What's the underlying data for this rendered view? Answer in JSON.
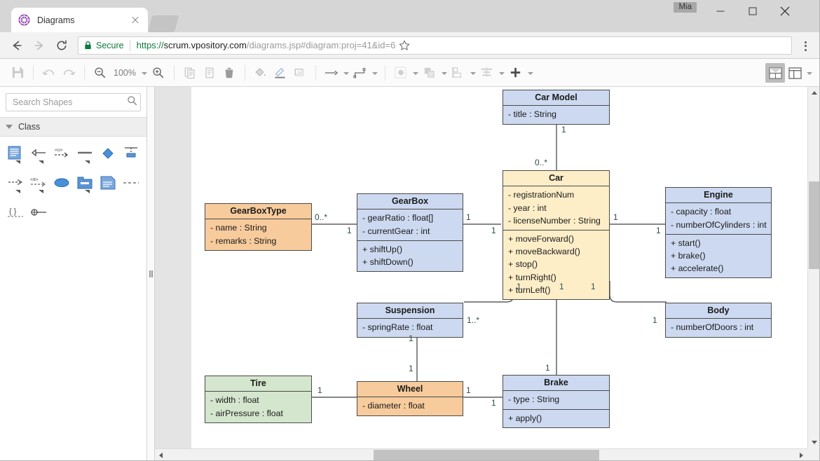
{
  "browser": {
    "tab": {
      "title": "Diagrams",
      "favicon": "visual-paradigm-icon",
      "close_icon": "close-icon"
    },
    "new_tab_icon": "new-tab-button",
    "window": {
      "user_label": "Mia",
      "minimize_icon": "minimize-icon",
      "maximize_icon": "maximize-icon",
      "close_icon": "window-close-icon"
    },
    "nav": {
      "back_icon": "back-arrow-icon",
      "forward_icon": "forward-arrow-icon",
      "reload_icon": "reload-icon",
      "lock_icon": "lock-icon",
      "secure_label": "Secure",
      "url_scheme": "https://",
      "url_host": "scrum.vpository.com",
      "url_path": "/diagrams.jsp#diagram:proj=41&id=6",
      "url_full": "https://scrum.vpository.com/diagrams.jsp#diagram:proj=41&id=6",
      "bookmark_icon": "star-icon",
      "menu_icon": "kebab-menu-icon"
    }
  },
  "toolbar": {
    "save_icon": "save-icon",
    "undo_icon": "undo-icon",
    "redo_icon": "redo-icon",
    "zoom_out_icon": "zoom-out-icon",
    "zoom_level": "100%",
    "zoom_dropdown_icon": "chevron-down-icon",
    "zoom_in_icon": "zoom-in-icon",
    "copy_icon": "copy-icon",
    "paste_icon": "paste-icon",
    "delete_icon": "trash-icon",
    "fill_color_icon": "fill-bucket-icon",
    "line_color_icon": "pen-line-icon",
    "shape_style_icon": "shape-style-icon",
    "connector_straight_icon": "straight-connector-icon",
    "connector_orthogonal_icon": "orthogonal-connector-icon",
    "select_icon": "marquee-select-icon",
    "arrange_icon": "bring-to-front-icon",
    "distribute_icon": "distribute-icon",
    "align_icon": "align-icon",
    "add_icon": "plus-icon",
    "panel_layout_icon": "panel-layout-icon",
    "view_layout_icon": "view-layout-icon",
    "view_dropdown_icon": "chevron-down-icon"
  },
  "sidebar": {
    "search": {
      "placeholder": "Search Shapes",
      "value": "",
      "icon": "search-icon"
    },
    "group": {
      "label": "Class",
      "expander_icon": "triangle-down-icon"
    },
    "shapes": [
      "class-icon",
      "generalization-icon",
      "usage-icon",
      "association-icon",
      "association-class-icon",
      "interface-icon",
      "dependency-icon",
      "anchor-icon",
      "ellipse-icon",
      "package-icon",
      "note-icon",
      "containment-icon",
      "constraint-icon",
      "port-icon"
    ]
  },
  "canvas": {
    "vscroll": {
      "up_icon": "scroll-up-arrow",
      "down_icon": "scroll-down-arrow"
    },
    "hscroll": {
      "left_icon": "scroll-left-arrow",
      "right_icon": "scroll-right-arrow"
    }
  },
  "diagram": {
    "type": "uml-class-diagram",
    "colors": {
      "blue": "#ccd9f0",
      "yellow": "#fdeec8",
      "orange": "#f7cb9c",
      "green": "#d4e6cd",
      "border": "#4b4b4b",
      "multiplicity_text": "#2f4f4f"
    },
    "classes": [
      {
        "id": "car-model",
        "name": "Car Model",
        "fill": "blue",
        "attributes": [
          "- title : String"
        ],
        "operations": []
      },
      {
        "id": "car",
        "name": "Car",
        "fill": "yellow",
        "attributes": [
          "- registrationNum",
          "- year : int",
          "- licenseNumber : String"
        ],
        "operations": [
          "+ moveForward()",
          "+ moveBackward()",
          "+ stop()",
          "+ turnRight()",
          "+ turnLeft()"
        ]
      },
      {
        "id": "gearboxtype",
        "name": "GearBoxType",
        "fill": "orange",
        "attributes": [
          "- name : String",
          "- remarks : String"
        ],
        "operations": []
      },
      {
        "id": "gearbox",
        "name": "GearBox",
        "fill": "blue",
        "attributes": [
          "- gearRatio : float[]",
          "- currentGear : int"
        ],
        "operations": [
          "+ shiftUp()",
          "+ shiftDown()"
        ]
      },
      {
        "id": "engine",
        "name": "Engine",
        "fill": "blue",
        "attributes": [
          "- capacity : float",
          "- numberOfCylinders : int"
        ],
        "operations": [
          "+ start()",
          "+ brake()",
          "+ accelerate()"
        ]
      },
      {
        "id": "suspension",
        "name": "Suspension",
        "fill": "blue",
        "attributes": [
          "- springRate : float"
        ],
        "operations": []
      },
      {
        "id": "body",
        "name": "Body",
        "fill": "blue",
        "attributes": [
          "- numberOfDoors : int"
        ],
        "operations": []
      },
      {
        "id": "tire",
        "name": "Tire",
        "fill": "green",
        "attributes": [
          "- width : float",
          "- airPressure : float"
        ],
        "operations": []
      },
      {
        "id": "wheel",
        "name": "Wheel",
        "fill": "orange",
        "attributes": [
          "- diameter : float"
        ],
        "operations": []
      },
      {
        "id": "brake",
        "name": "Brake",
        "fill": "blue",
        "attributes": [
          "- type : String"
        ],
        "operations": [
          "+ apply()"
        ]
      }
    ],
    "associations": [
      {
        "from": "car-model",
        "to": "car",
        "from_mult": "1",
        "to_mult": "0..*"
      },
      {
        "from": "gearboxtype",
        "to": "gearbox",
        "from_mult": "0..*",
        "to_mult": "1"
      },
      {
        "from": "gearbox",
        "to": "car",
        "from_mult": "1",
        "to_mult": "1"
      },
      {
        "from": "car",
        "to": "engine",
        "from_mult": "1",
        "to_mult": "1"
      },
      {
        "from": "car",
        "to": "suspension",
        "from_mult": "1",
        "to_mult": "1..*"
      },
      {
        "from": "car",
        "to": "body",
        "from_mult": "1",
        "to_mult": "1"
      },
      {
        "from": "car",
        "to": "brake",
        "from_mult": "1",
        "to_mult": "1"
      },
      {
        "from": "suspension",
        "to": "wheel",
        "from_mult": "1",
        "to_mult": "1"
      },
      {
        "from": "tire",
        "to": "wheel",
        "from_mult": "1",
        "to_mult": "1"
      },
      {
        "from": "wheel",
        "to": "brake",
        "from_mult": "1",
        "to_mult": "1"
      }
    ],
    "multiplicity_labels": [
      "1",
      "0..*",
      "0..*",
      "1",
      "1",
      "1",
      "1",
      "1",
      "1",
      "1..*",
      "1",
      "1",
      "1",
      "1",
      "1",
      "1",
      "1",
      "1"
    ]
  }
}
